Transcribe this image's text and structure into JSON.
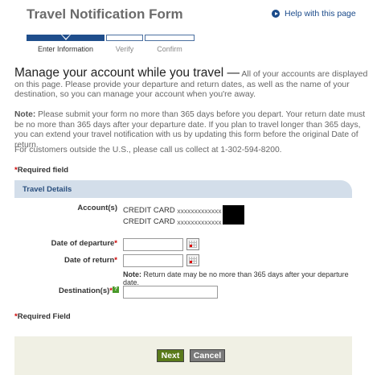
{
  "header": {
    "title": "Travel Notification Form",
    "help_link": "Help with this page",
    "help_icon": "play-circle-icon"
  },
  "steps": [
    {
      "label": "Enter Information",
      "active": true
    },
    {
      "label": "Verify",
      "active": false
    },
    {
      "label": "Confirm",
      "active": false
    }
  ],
  "intro": {
    "headline": "Manage your account while you travel —",
    "body": " All of your accounts are displayed on this page. Please provide your departure and return dates, as well as the name of your destination, so you can manage your account when you're away."
  },
  "note": {
    "label": "Note:",
    "text": " Please submit your form no more than 365 days before you depart. Your return date must be no more than 365 days after your departure date. If you plan to travel longer than 365 days, you can extend your travel notification with us by updating this form before the original Date of return."
  },
  "customers_text": "For customers outside the U.S., please call us collect at 1-302-594-8200.",
  "required_top": "Required field",
  "required_bottom": "Required Field",
  "section_title": "Travel Details",
  "form": {
    "accounts_label": "Account(s)",
    "accounts": [
      {
        "type": "CREDIT CARD",
        "mask": "xxxxxxxxxxxxx"
      },
      {
        "type": "CREDIT CARD",
        "mask": "xxxxxxxxxxxxx"
      }
    ],
    "departure_label": "Date of departure",
    "departure_value": "",
    "return_label": "Date of return",
    "return_value": "",
    "return_note_label": "Note:",
    "return_note_text": " Return date may be no more than 365 days after your departure date.",
    "destination_label": "Destination(s)",
    "destination_value": "",
    "help_badge": "?"
  },
  "buttons": {
    "next": "Next",
    "cancel": "Cancel"
  },
  "colors": {
    "accent": "#1f4e8c",
    "required_star": "#cc0000",
    "next_button": "#5a7a1a",
    "cancel_button": "#7a7a7a"
  }
}
